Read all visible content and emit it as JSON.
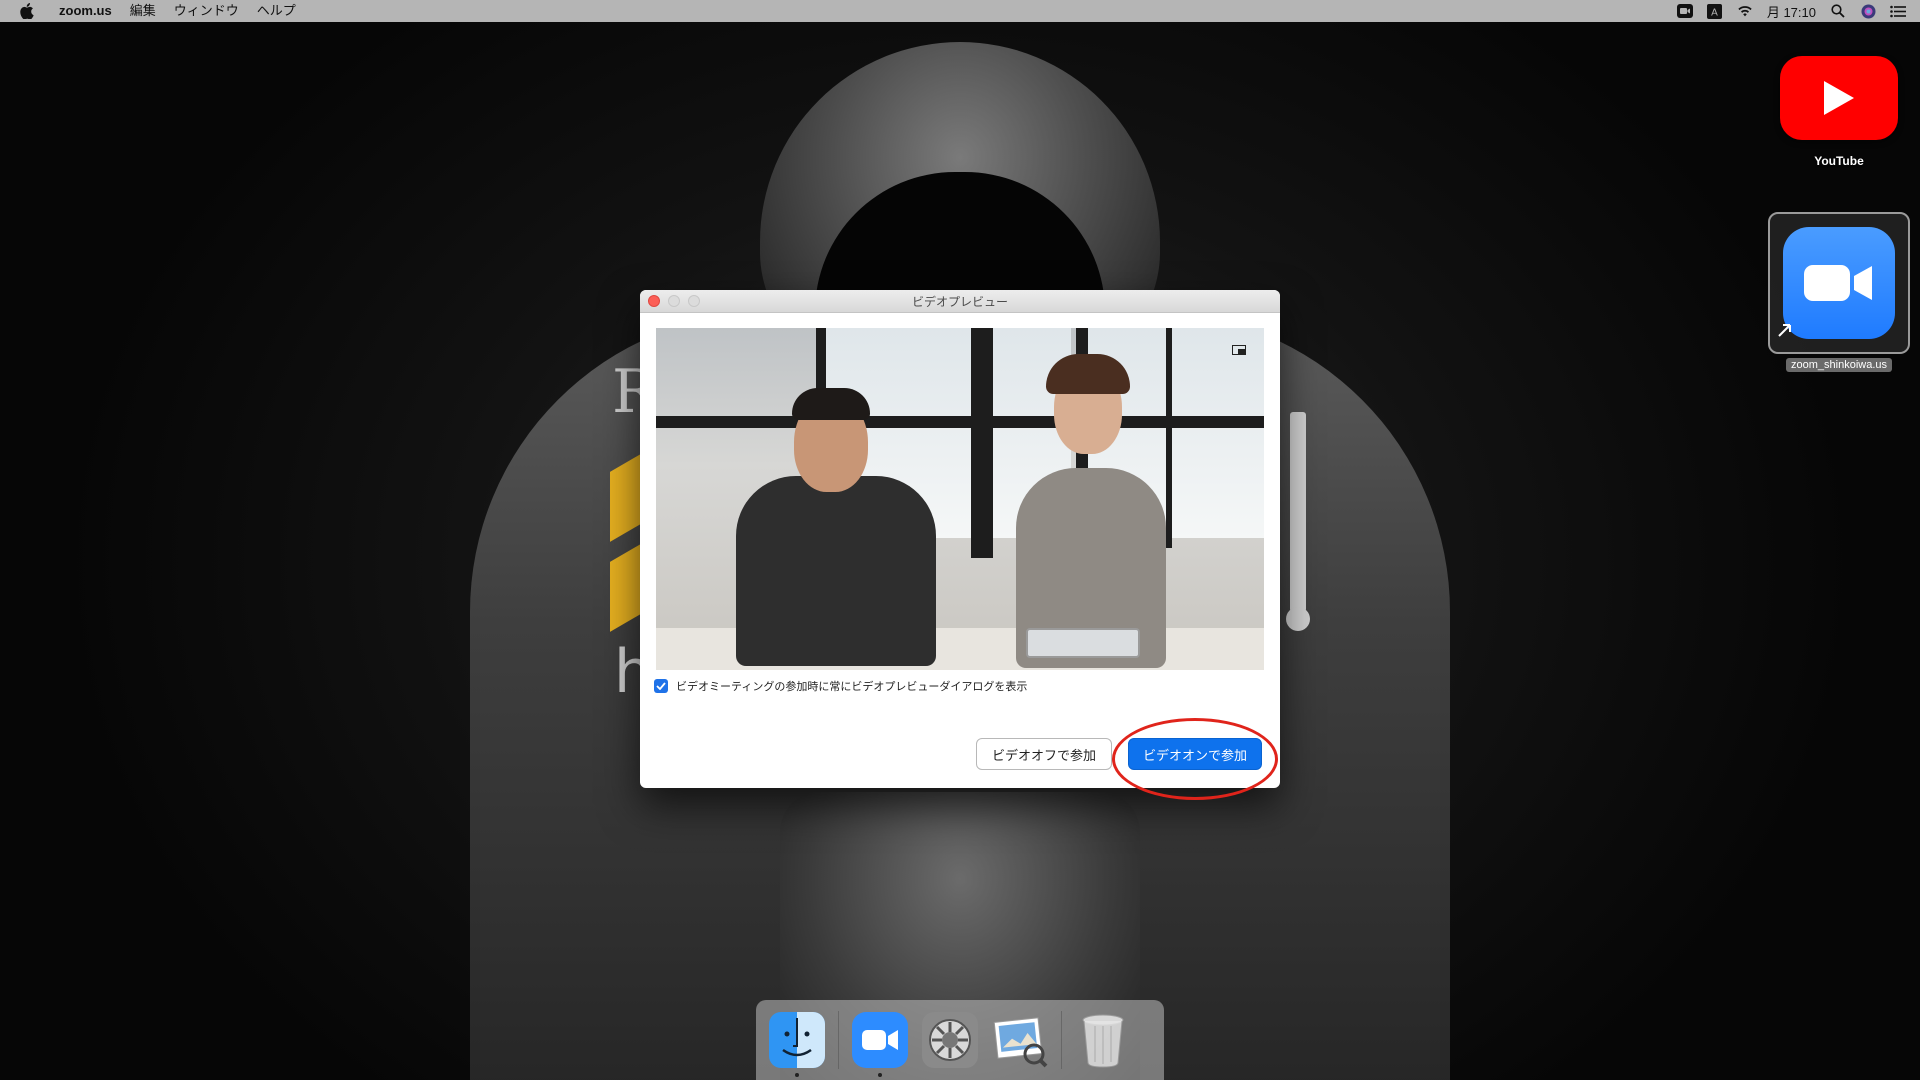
{
  "menubar": {
    "app_name": "zoom.us",
    "items": [
      "編集",
      "ウィンドウ",
      "ヘルプ"
    ],
    "clock": "月 17:10"
  },
  "desktop": {
    "youtube_label": "YouTube",
    "zoom_label": "zoom_shinkoiwa.us"
  },
  "dialog": {
    "title": "ビデオプレビュー",
    "checkbox_label": "ビデオミーティングの参加時に常にビデオプレビューダイアログを表示",
    "checkbox_checked": true,
    "join_video_off": "ビデオオフで参加",
    "join_video_on": "ビデオオンで参加"
  },
  "dock": {
    "items": [
      "finder-icon",
      "zoom-icon",
      "system-preferences-icon",
      "preview-icon",
      "trash-icon"
    ]
  },
  "colors": {
    "primary_button": "#0e72ed",
    "annotation_ring": "#e0241b",
    "youtube_red": "#ff0000",
    "zoom_blue": "#2d8cff"
  }
}
